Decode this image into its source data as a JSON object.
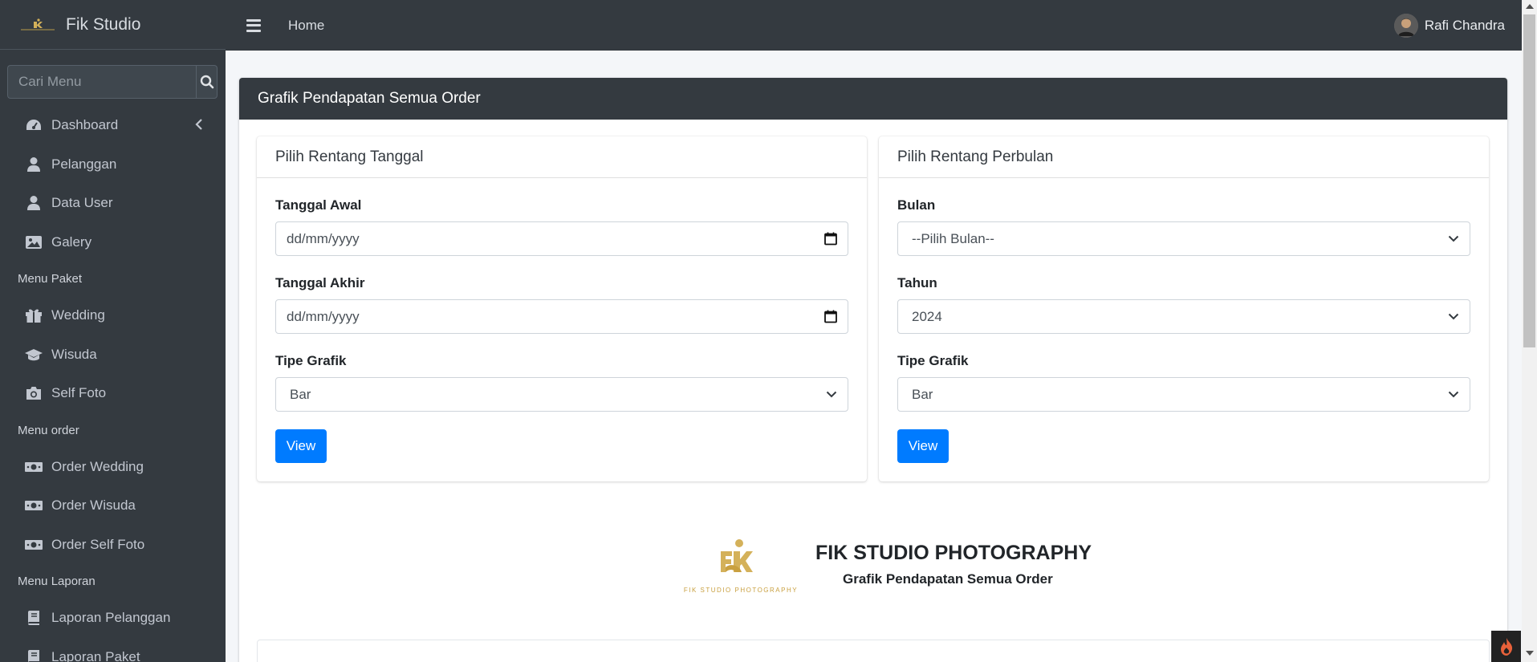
{
  "brand": {
    "name": "Fik Studio"
  },
  "sidebar": {
    "search_placeholder": "Cari Menu",
    "items": [
      {
        "label": "Dashboard",
        "icon": "dashboard-icon"
      },
      {
        "label": "Pelanggan",
        "icon": "user-icon"
      },
      {
        "label": "Data User",
        "icon": "user-icon"
      },
      {
        "label": "Galery",
        "icon": "image-icon"
      }
    ],
    "header_paket": "Menu Paket",
    "paket_items": [
      {
        "label": "Wedding",
        "icon": "gift-icon"
      },
      {
        "label": "Wisuda",
        "icon": "graduation-cap-icon"
      },
      {
        "label": "Self Foto",
        "icon": "camera-icon"
      }
    ],
    "header_order": "Menu order",
    "order_items": [
      {
        "label": "Order Wedding",
        "icon": "money-icon"
      },
      {
        "label": "Order Wisuda",
        "icon": "money-icon"
      },
      {
        "label": "Order Self Foto",
        "icon": "money-icon"
      }
    ],
    "header_laporan": "Menu Laporan",
    "laporan_items": [
      {
        "label": "Laporan Pelanggan",
        "icon": "book-icon"
      },
      {
        "label": "Laporan Paket",
        "icon": "book-icon"
      }
    ]
  },
  "topbar": {
    "home": "Home",
    "user_name": "Rafi Chandra"
  },
  "main": {
    "title": "Grafik Pendapatan Semua Order",
    "left_card": {
      "title": "Pilih Rentang Tanggal",
      "start_label": "Tanggal Awal",
      "start_value": "dd/mm/yyyy",
      "end_label": "Tanggal Akhir",
      "end_value": "dd/mm/yyyy",
      "chart_type_label": "Tipe Grafik",
      "chart_type_value": "Bar",
      "view_button": "View"
    },
    "right_card": {
      "title": "Pilih Rentang Perbulan",
      "month_label": "Bulan",
      "month_value": "--Pilih Bulan--",
      "year_label": "Tahun",
      "year_value": "2024",
      "chart_type_label": "Tipe Grafik",
      "chart_type_value": "Bar",
      "view_button": "View"
    },
    "report": {
      "title": "FIK STUDIO PHOTOGRAPHY",
      "subtitle": "Grafik Pendapatan Semua Order",
      "logo_text": "FIK STUDIO PHOTOGRAPHY"
    }
  },
  "colors": {
    "sidebar_bg": "#343a40",
    "accent": "#007bff",
    "logo_gold": "#d4b15a"
  }
}
